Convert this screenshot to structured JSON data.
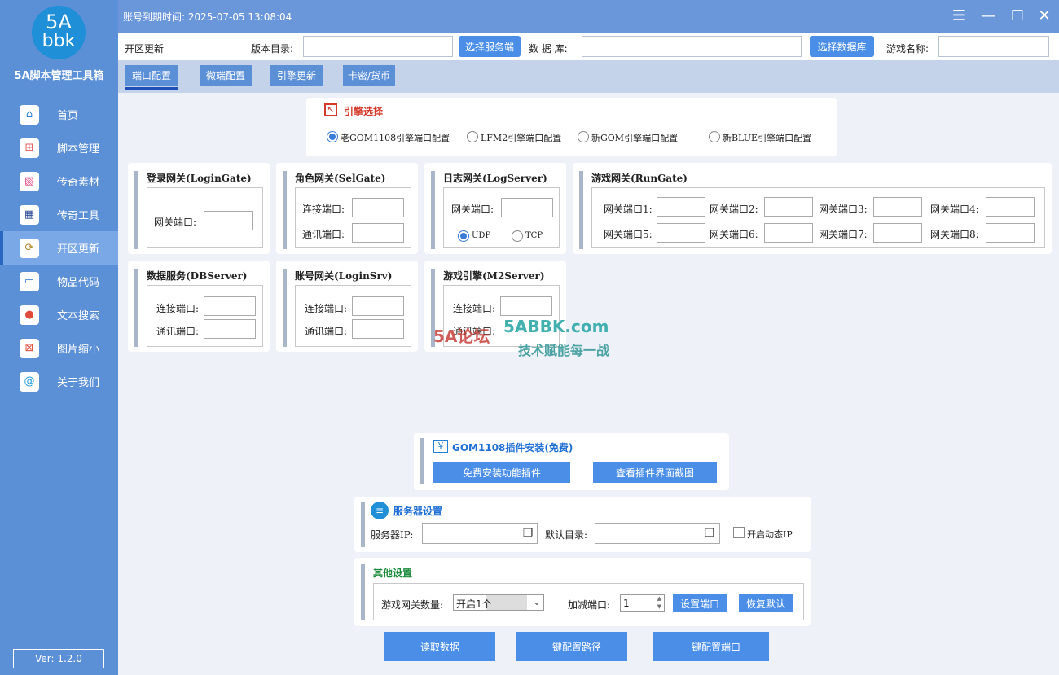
{
  "sidebar": {
    "logo_line1": "5A",
    "logo_line2": "bbk",
    "app_name": "5A脚本管理工具箱",
    "items": [
      {
        "label": "首页",
        "icon": "home-icon"
      },
      {
        "label": "脚本管理",
        "icon": "script-icon"
      },
      {
        "label": "传奇素材",
        "icon": "image-icon"
      },
      {
        "label": "传奇工具",
        "icon": "grid-icon"
      },
      {
        "label": "开区更新",
        "icon": "update-icon"
      },
      {
        "label": "物品代码",
        "icon": "monitor-icon"
      },
      {
        "label": "文本搜索",
        "icon": "search-icon"
      },
      {
        "label": "图片缩小",
        "icon": "compress-icon"
      },
      {
        "label": "关于我们",
        "icon": "at-icon"
      }
    ],
    "version": "Ver: 1.2.0"
  },
  "titlebar": {
    "expiry": "账号到期时间: 2025-07-05 13:08:04"
  },
  "pathbar": {
    "section": "开区更新",
    "version_dir_label": "版本目录:",
    "select_server_btn": "选择服务端",
    "database_label": "数 据 库:",
    "select_db_btn": "选择数据库",
    "game_name_label": "游戏名称:"
  },
  "tabs": [
    "端口配置",
    "微端配置",
    "引擎更新",
    "卡密/货币"
  ],
  "engine": {
    "title": "引擎选择",
    "options": [
      "老GOM1108引擎端口配置",
      "LFM2引擎端口配置",
      "新GOM引擎端口配置",
      "新BLUE引擎端口配置"
    ]
  },
  "gates": {
    "login_gate": {
      "title": "登录网关(LoginGate)",
      "port": "网关端口:"
    },
    "sel_gate": {
      "title": "角色网关(SelGate)",
      "connect": "连接端口:",
      "comm": "通讯端口:"
    },
    "log_server": {
      "title": "日志网关(LogServer)",
      "port": "网关端口:",
      "udp": "UDP",
      "tcp": "TCP"
    },
    "run_gate": {
      "title": "游戏网关(RunGate)",
      "ports": [
        "网关端口1:",
        "网关端口2:",
        "网关端口3:",
        "网关端口4:",
        "网关端口5:",
        "网关端口6:",
        "网关端口7:",
        "网关端口8:"
      ]
    },
    "db_server": {
      "title": "数据服务(DBServer)",
      "connect": "连接端口:",
      "comm": "通讯端口:"
    },
    "login_srv": {
      "title": "账号网关(LoginSrv)",
      "connect": "连接端口:",
      "comm": "通讯端口:"
    },
    "m2_server": {
      "title": "游戏引擎(M2Server)",
      "connect": "连接端口:",
      "comm": "通讯端口:"
    }
  },
  "watermark": {
    "site": "5ABBK.com",
    "slogan": "技术赋能每一战",
    "brand": "5A论坛"
  },
  "plugin": {
    "title": "GOM1108插件安装(免费)",
    "install_btn": "免费安装功能插件",
    "view_btn": "查看插件界面截图"
  },
  "server": {
    "title": "服务器设置",
    "ip_label": "服务器IP:",
    "dir_label": "默认目录:",
    "dynamic_ip": "开启动态IP"
  },
  "other": {
    "title": "其他设置",
    "gate_count_label": "游戏网关数量:",
    "gate_count_value": "开启1个",
    "offset_label": "加减端口:",
    "offset_value": "1",
    "set_port_btn": "设置端口",
    "restore_btn": "恢复默认"
  },
  "footer": {
    "read_btn": "读取数据",
    "config_path_btn": "一键配置路径",
    "config_port_btn": "一键配置端口"
  }
}
